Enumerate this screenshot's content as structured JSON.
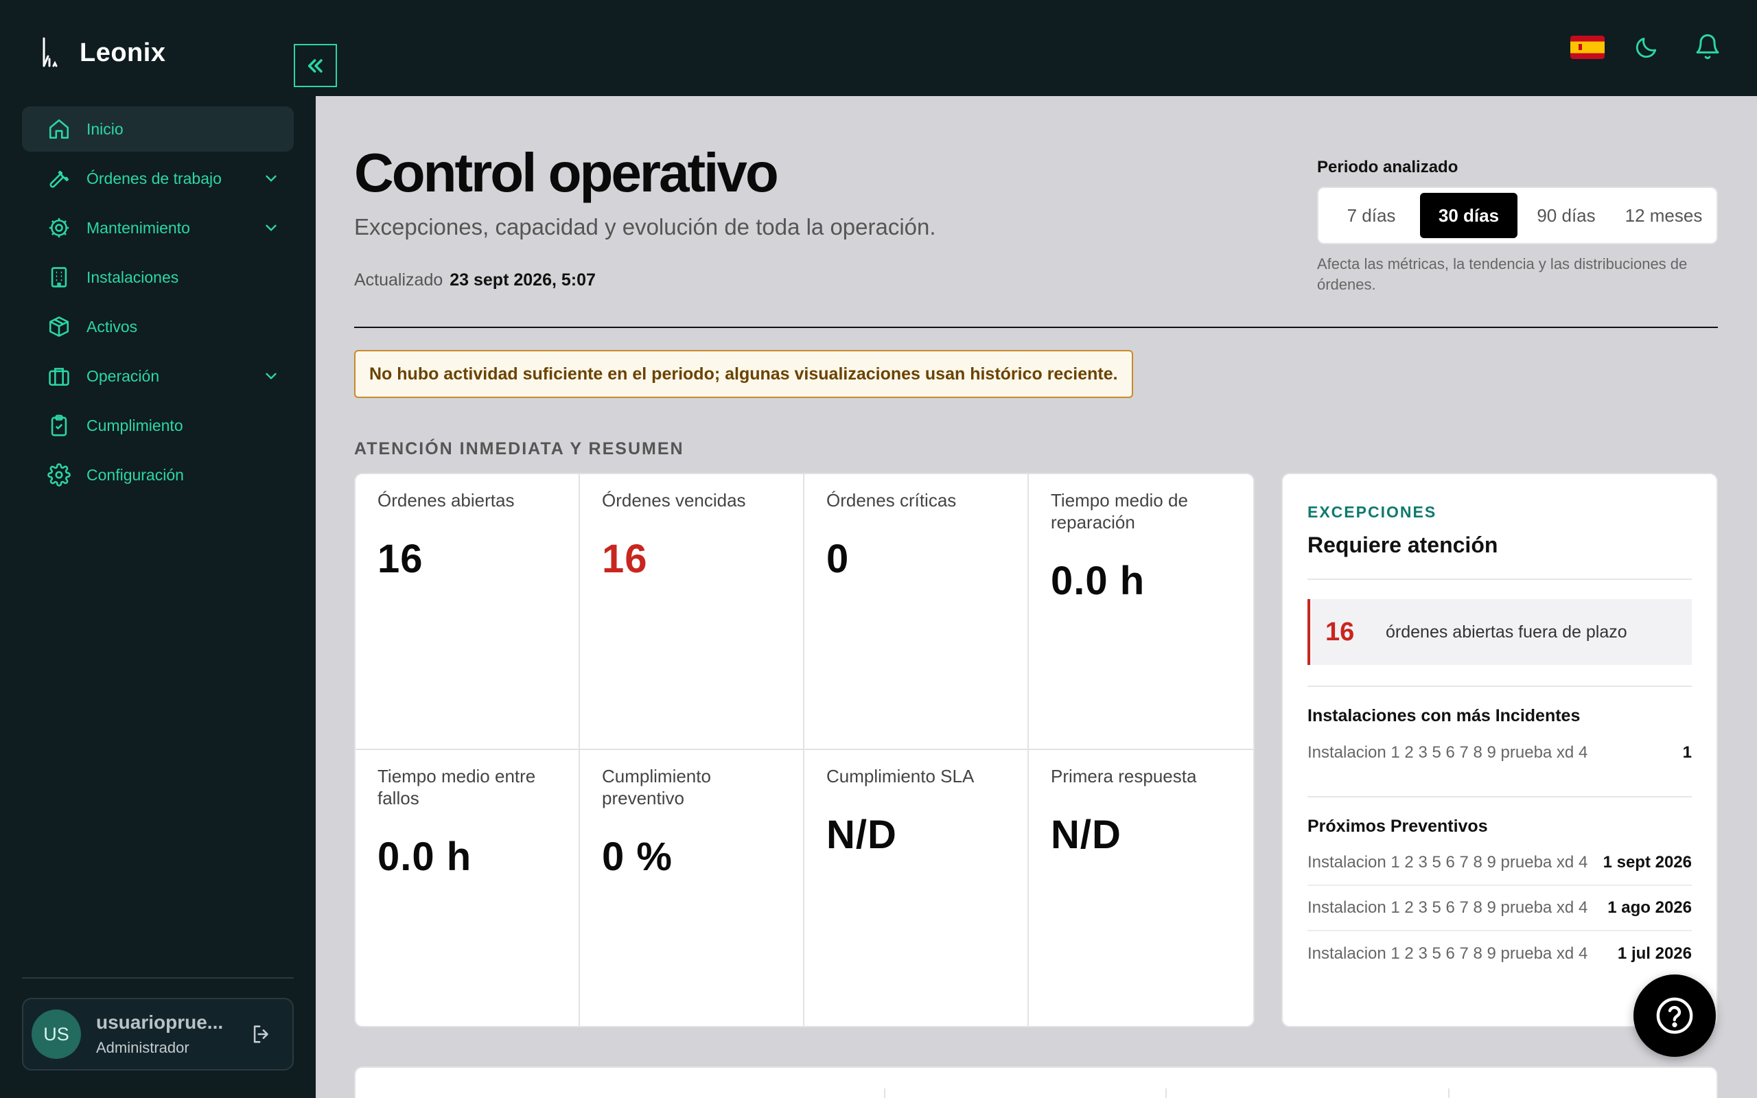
{
  "brand": {
    "name": "Leonix"
  },
  "sidebar": {
    "items": [
      {
        "label": "Inicio",
        "icon": "home-icon",
        "active": true,
        "expandable": false
      },
      {
        "label": "Órdenes de trabajo",
        "icon": "wrench-icon",
        "active": false,
        "expandable": true
      },
      {
        "label": "Mantenimiento",
        "icon": "cog-icon",
        "active": false,
        "expandable": true
      },
      {
        "label": "Instalaciones",
        "icon": "building-icon",
        "active": false,
        "expandable": false
      },
      {
        "label": "Activos",
        "icon": "box-icon",
        "active": false,
        "expandable": false
      },
      {
        "label": "Operación",
        "icon": "briefcase-icon",
        "active": false,
        "expandable": true
      },
      {
        "label": "Cumplimiento",
        "icon": "clipboard-check-icon",
        "active": false,
        "expandable": false
      },
      {
        "label": "Configuración",
        "icon": "settings-icon",
        "active": false,
        "expandable": false
      }
    ]
  },
  "user": {
    "initials": "US",
    "name": "usuarioprue...",
    "role": "Administrador"
  },
  "page": {
    "title": "Control operativo",
    "subtitle": "Excepciones, capacidad y evolución de toda la operación.",
    "updated_label": "Actualizado",
    "updated_value": "23 sept 2026, 5:07"
  },
  "period": {
    "label": "Periodo analizado",
    "options": [
      "7 días",
      "30 días",
      "90 días",
      "12 meses"
    ],
    "selected": "30 días",
    "note": "Afecta las métricas, la tendencia y las distribuciones de órdenes."
  },
  "warning": "No hubo actividad suficiente en el periodo; algunas visualizaciones usan histórico reciente.",
  "section_title": "ATENCIÓN INMEDIATA Y RESUMEN",
  "kpis": [
    {
      "label": "Órdenes abiertas",
      "value": "16"
    },
    {
      "label": "Órdenes vencidas",
      "value": "16"
    },
    {
      "label": "Órdenes críticas",
      "value": "0"
    },
    {
      "label": "Tiempo medio de reparación",
      "value": "0.0 h"
    },
    {
      "label": "Tiempo medio entre fallos",
      "value": "0.0 h"
    },
    {
      "label": "Cumplimiento preventivo",
      "value": "0 %"
    },
    {
      "label": "Cumplimiento SLA",
      "value": "N/D"
    },
    {
      "label": "Primera respuesta",
      "value": "N/D"
    }
  ],
  "exceptions": {
    "eyebrow": "EXCEPCIONES",
    "title": "Requiere atención",
    "alert": {
      "count": "16",
      "text": "órdenes abiertas fuera de plazo"
    },
    "top_installations": {
      "title": "Instalaciones con más Incidentes",
      "rows": [
        {
          "name": "Instalacion 1 2 3 5 6 7 8 9 prueba xd 4",
          "value": "1"
        }
      ]
    },
    "upcoming": {
      "title": "Próximos Preventivos",
      "rows": [
        {
          "name": "Instalacion 1 2 3 5 6 7 8 9 prueba xd 4",
          "value": "1 sept 2026"
        },
        {
          "name": "Instalacion 1 2 3 5 6 7 8 9 prueba xd 4",
          "value": "1 ago 2026"
        },
        {
          "name": "Instalacion 1 2 3 5 6 7 8 9 prueba xd 4",
          "value": "1 jul 2026"
        }
      ]
    }
  },
  "colors": {
    "accent": "#2bd7a6",
    "sidebar_bg": "#0f1c20",
    "danger": "#c8261e",
    "teal_text": "#0e7a6d"
  }
}
